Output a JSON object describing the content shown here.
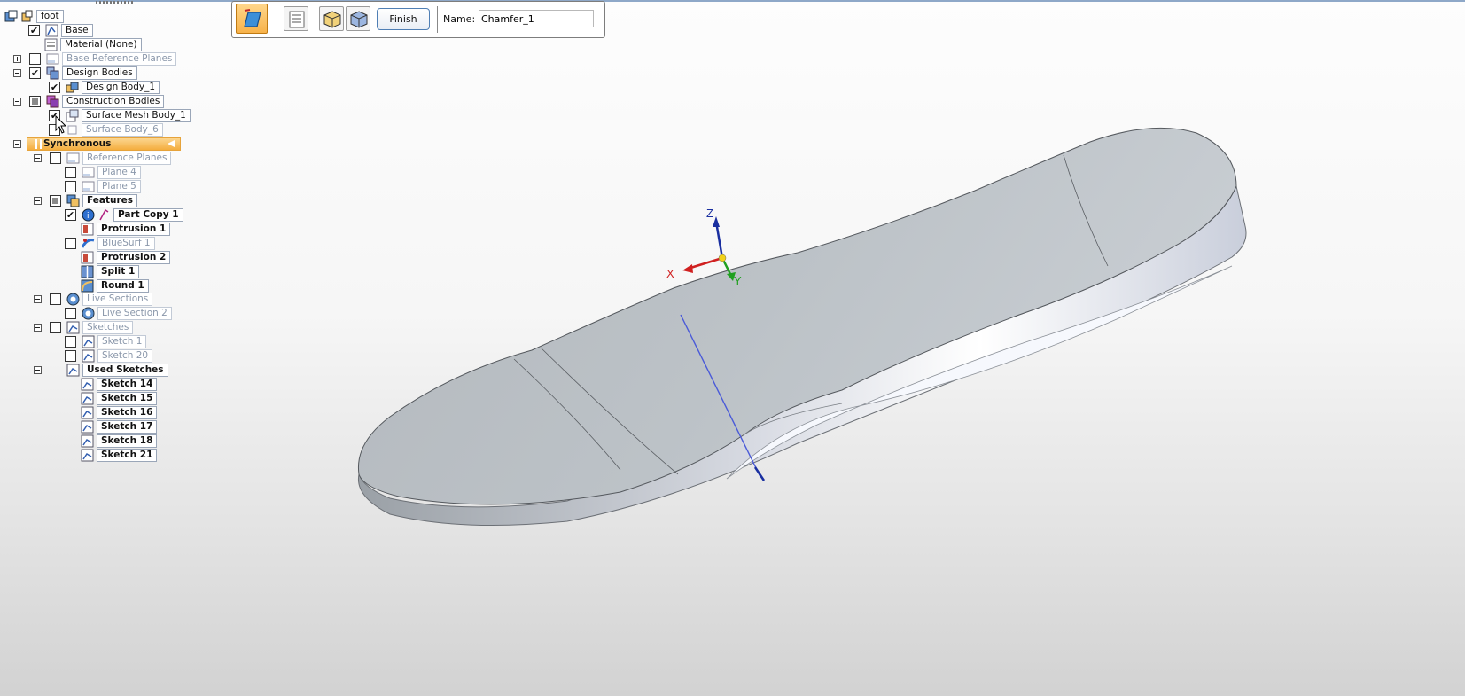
{
  "toolbar": {
    "finish_label": "Finish",
    "name_label": "Name:",
    "name_value": "Chamfer_1"
  },
  "tree": {
    "root": "foot",
    "base": "Base",
    "material": "Material (None)",
    "base_ref_planes": "Base Reference Planes",
    "design_bodies": "Design Bodies",
    "design_body_1": "Design Body_1",
    "construction_bodies": "Construction Bodies",
    "surface_mesh_body": "Surface Mesh Body_1",
    "surface_body_6": "Surface Body_6",
    "synchronous": "Synchronous",
    "reference_planes": "Reference Planes",
    "plane_4": "Plane 4",
    "plane_5": "Plane 5",
    "features": "Features",
    "part_copy": "Part Copy 1",
    "protrusion_1": "Protrusion 1",
    "bluesurf": "BlueSurf 1",
    "protrusion_2": "Protrusion 2",
    "split": "Split 1",
    "round": "Round 1",
    "live_sections": "Live Sections",
    "live_section_2": "Live Section 2",
    "sketches": "Sketches",
    "sketch_1": "Sketch 1",
    "sketch_20": "Sketch 20",
    "used_sketches": "Used Sketches",
    "used": [
      "Sketch 14",
      "Sketch 15",
      "Sketch 16",
      "Sketch 17",
      "Sketch 18",
      "Sketch 21"
    ]
  },
  "triad": {
    "x": "X",
    "y": "Y",
    "z": "Z"
  },
  "colors": {
    "active_row": "#f4ad3e",
    "axis_x": "#d02020",
    "axis_y": "#20a020",
    "axis_z": "#1a2fa0",
    "model_top": "#b8bec4",
    "model_side": "#eef0f6"
  },
  "icons": [
    "part-icon",
    "base-icon",
    "material-icon",
    "plane-icon",
    "body-icon",
    "construction-icon",
    "synchronous-icon",
    "features-icon",
    "info-icon",
    "protrusion-icon",
    "bluesurf-icon",
    "split-icon",
    "round-icon",
    "live-section-icon",
    "sketch-icon"
  ]
}
